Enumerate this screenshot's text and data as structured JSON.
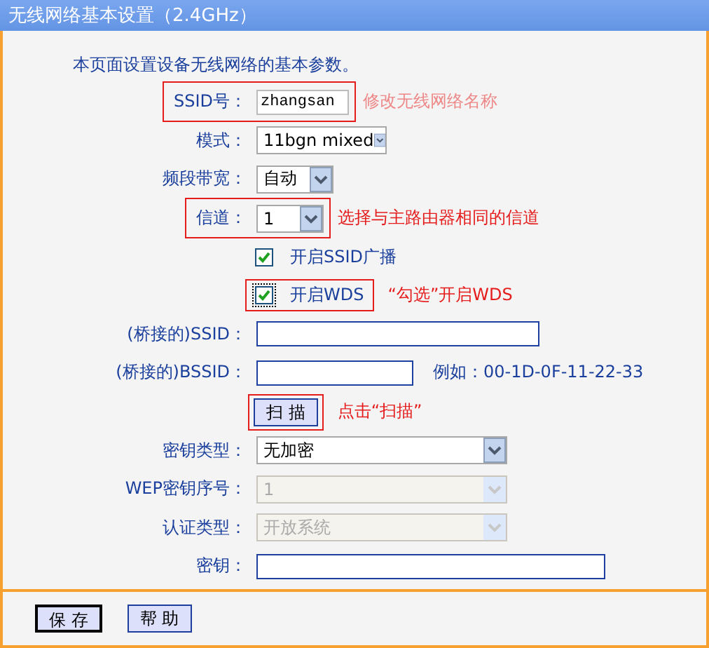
{
  "window": {
    "title": "无线网络基本设置（2.4GHz）"
  },
  "intro": "本页面设置设备无线网络的基本参数。",
  "fields": [
    {
      "kind": "input",
      "label": "SSID号：",
      "value": "zhangsan",
      "highlighted": true,
      "note": "修改无线网络名称"
    },
    {
      "kind": "select",
      "label": "模式：",
      "value": "11bgn mixed",
      "disabled": false,
      "highlighted": false
    },
    {
      "kind": "select",
      "label": "频段带宽：",
      "value": "自动",
      "disabled": false,
      "highlighted": false
    },
    {
      "kind": "select",
      "label": "信道：",
      "value": "1",
      "disabled": false,
      "highlighted": true,
      "note": "选择与主路由器相同的信道"
    },
    {
      "kind": "checkbox",
      "label": "开启SSID广播",
      "checked": true,
      "highlighted": false
    },
    {
      "kind": "checkbox",
      "label": "开启WDS",
      "checked": true,
      "highlighted": true,
      "note": "“勾选”开启WDS"
    },
    {
      "kind": "input",
      "label": "(桥接的)SSID：",
      "highlighted": false
    },
    {
      "kind": "input",
      "label": "(桥接的)BSSID：",
      "highlighted": false,
      "hint": "例如：00-1D-0F-11-22-33"
    },
    {
      "kind": "button",
      "label": "扫 描",
      "highlighted": true,
      "note": "点击“扫描”"
    },
    {
      "kind": "select",
      "label": "密钥类型：",
      "value": "无加密",
      "disabled": false,
      "highlighted": false
    },
    {
      "kind": "select",
      "label": "WEP密钥序号：",
      "value": "1",
      "disabled": true,
      "highlighted": false
    },
    {
      "kind": "select",
      "label": "认证类型：",
      "value": "开放系统",
      "disabled": true,
      "highlighted": false
    },
    {
      "kind": "input",
      "label": "密钥：",
      "highlighted": false
    }
  ],
  "buttons": [
    {
      "label": "保 存",
      "focused": true
    },
    {
      "label": "帮 助",
      "focused": false
    }
  ]
}
